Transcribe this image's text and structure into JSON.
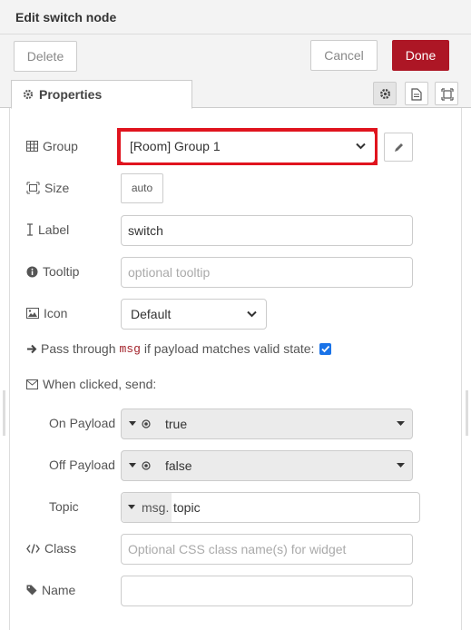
{
  "header": {
    "title": "Edit switch node"
  },
  "toolbar": {
    "delete_label": "Delete",
    "cancel_label": "Cancel",
    "done_label": "Done"
  },
  "tabs": {
    "properties_label": "Properties"
  },
  "form": {
    "group": {
      "label": "Group",
      "value": "[Room] Group 1"
    },
    "size": {
      "label": "Size",
      "value": "auto"
    },
    "label": {
      "label": "Label",
      "value": "switch"
    },
    "tooltip": {
      "label": "Tooltip",
      "placeholder": "optional tooltip"
    },
    "icon": {
      "label": "Icon",
      "value": "Default"
    },
    "passthrough": {
      "prefix": "Pass through",
      "code": "msg",
      "suffix": "if payload matches valid state:",
      "checked": true
    },
    "when_clicked": {
      "label": "When clicked, send:"
    },
    "on_payload": {
      "label": "On Payload",
      "value": "true"
    },
    "off_payload": {
      "label": "Off Payload",
      "value": "false"
    },
    "topic": {
      "label": "Topic",
      "prefix": "msg.",
      "value": "topic"
    },
    "class": {
      "label": "Class",
      "placeholder": "Optional CSS class name(s) for widget"
    },
    "name": {
      "label": "Name",
      "value": ""
    }
  },
  "colors": {
    "done": "#ad1625",
    "highlight": "#e0141e",
    "checkbox": "#1a73e8"
  }
}
